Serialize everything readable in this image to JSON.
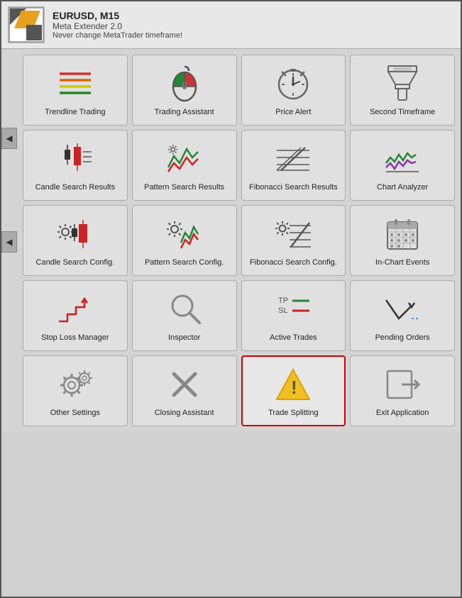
{
  "header": {
    "pair": "EURUSD, M15",
    "app": "Meta Extender 2.0",
    "warning": "Never change MetaTrader timeframe!"
  },
  "nav": {
    "left_arrow": "◀"
  },
  "grid_items": [
    {
      "id": "trendline-trading",
      "label": "Trendline\nTrading",
      "icon": "trendline",
      "highlighted": false
    },
    {
      "id": "trading-assistant",
      "label": "Trading\nAssistant",
      "icon": "mouse",
      "highlighted": false
    },
    {
      "id": "price-alert",
      "label": "Price\nAlert",
      "icon": "clock",
      "highlighted": false
    },
    {
      "id": "second-timeframe",
      "label": "Second\nTimeframe",
      "icon": "funnel",
      "highlighted": false
    },
    {
      "id": "candle-search-results",
      "label": "Candle\nSearch Results",
      "icon": "candle-results",
      "highlighted": false
    },
    {
      "id": "pattern-search-results",
      "label": "Pattern\nSearch Results",
      "icon": "pattern-results",
      "highlighted": false
    },
    {
      "id": "fibonacci-search-results",
      "label": "Fibonacci\nSearch Results",
      "icon": "fibonacci-results",
      "highlighted": false
    },
    {
      "id": "chart-analyzer",
      "label": "Chart\nAnalyzer",
      "icon": "chart-analyzer",
      "highlighted": false
    },
    {
      "id": "candle-search-config",
      "label": "Candle\nSearch Config.",
      "icon": "candle-config",
      "highlighted": false
    },
    {
      "id": "pattern-search-config",
      "label": "Pattern\nSearch Config.",
      "icon": "pattern-config",
      "highlighted": false
    },
    {
      "id": "fibonacci-search-config",
      "label": "Fibonacci\nSearch Config.",
      "icon": "fibonacci-config",
      "highlighted": false
    },
    {
      "id": "in-chart-events",
      "label": "In-Chart\nEvents",
      "icon": "calendar",
      "highlighted": false
    },
    {
      "id": "stop-loss-manager",
      "label": "Stop Loss\nManager",
      "icon": "stop-loss",
      "highlighted": false
    },
    {
      "id": "inspector",
      "label": "Inspector",
      "icon": "magnifier",
      "highlighted": false
    },
    {
      "id": "active-trades",
      "label": "Active\nTrades",
      "icon": "active-trades",
      "highlighted": false
    },
    {
      "id": "pending-orders",
      "label": "Pending\nOrders",
      "icon": "pending-orders",
      "highlighted": false
    },
    {
      "id": "other-settings",
      "label": "Other\nSettings",
      "icon": "gears",
      "highlighted": false
    },
    {
      "id": "closing-assistant",
      "label": "Closing\nAssistant",
      "icon": "x-mark",
      "highlighted": false
    },
    {
      "id": "trade-splitting",
      "label": "Trade\nSplitting",
      "icon": "warning",
      "highlighted": true
    },
    {
      "id": "exit-application",
      "label": "Exit\nApplication",
      "icon": "exit",
      "highlighted": false
    }
  ]
}
